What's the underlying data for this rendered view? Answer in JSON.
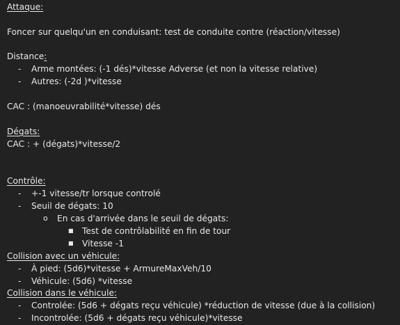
{
  "attaque": {
    "heading": "Attaque:",
    "text": "Foncer sur quelqu'un en conduisant: test de conduite contre (réaction/vitesse)"
  },
  "distance": {
    "heading_main": "Distance",
    "heading_colon": ":",
    "items": [
      "Arme montées:  (-1 dés)*vitesse Adverse (et non la vitesse relative)",
      "Autres: (-2d )*vitesse"
    ],
    "cac": "CAC : (manoeuvrabilité*vitesse) dés"
  },
  "degats": {
    "heading": "Dégats:",
    "cac": "CAC : + (dégats)*vitesse/2"
  },
  "controle": {
    "heading": "Contrôle:",
    "items": [
      "+-1 vitesse/tr lorsque controlé",
      "Seuil de dégats: 10"
    ],
    "sub_item": "En cas d'arrivée dans le seuil de dégats:",
    "sub_sub_items": [
      "Test de contrôlabilité en fin de tour",
      "Vitesse -1"
    ]
  },
  "collision_vehicule": {
    "heading": "Collision avec un véhicule:",
    "items": [
      "À pied: (5d6)*vitesse +  ArmureMaxVeh/10",
      "Véhicule: (5d6) *vitesse"
    ]
  },
  "collision_dans": {
    "heading": "Collision dans le véhicule:",
    "items": [
      "Controlée: (5d6 + dégats reçu véhicule) *réduction de vitesse (due à la collision)",
      "Incontrolée: (5d6 + dégats reçu véhicule)*vitesse"
    ]
  },
  "glyphs": {
    "dash": "-",
    "circle": "o",
    "square": "■"
  }
}
